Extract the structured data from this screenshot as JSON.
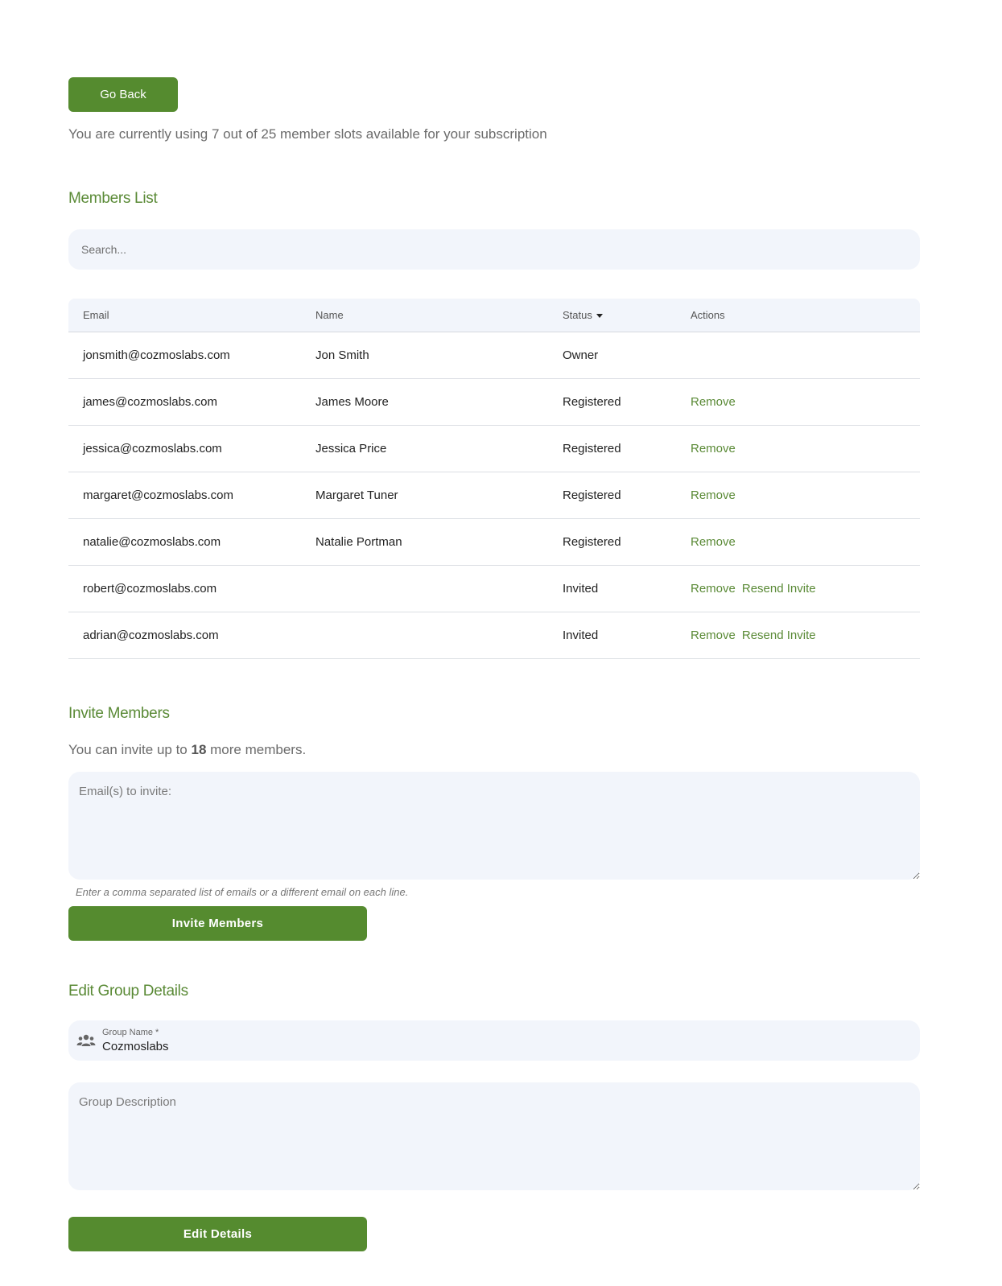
{
  "top": {
    "go_back_label": "Go Back",
    "usage_text": "You are currently using 7 out of 25 member slots available for your subscription"
  },
  "members": {
    "title": "Members List",
    "search_placeholder": "Search...",
    "columns": [
      "Email",
      "Name",
      "Status",
      "Actions"
    ],
    "rows": [
      {
        "email": "jonsmith@cozmoslabs.com",
        "name": "Jon Smith",
        "status": "Owner",
        "actions": []
      },
      {
        "email": "james@cozmoslabs.com",
        "name": "James Moore",
        "status": "Registered",
        "actions": [
          "Remove"
        ]
      },
      {
        "email": "jessica@cozmoslabs.com",
        "name": "Jessica Price",
        "status": "Registered",
        "actions": [
          "Remove"
        ]
      },
      {
        "email": "margaret@cozmoslabs.com",
        "name": "Margaret Tuner",
        "status": "Registered",
        "actions": [
          "Remove"
        ]
      },
      {
        "email": "natalie@cozmoslabs.com",
        "name": "Natalie Portman",
        "status": "Registered",
        "actions": [
          "Remove"
        ]
      },
      {
        "email": "robert@cozmoslabs.com",
        "name": "",
        "status": "Invited",
        "actions": [
          "Remove",
          "Resend Invite"
        ]
      },
      {
        "email": "adrian@cozmoslabs.com",
        "name": "",
        "status": "Invited",
        "actions": [
          "Remove",
          "Resend Invite"
        ]
      }
    ]
  },
  "invite": {
    "title": "Invite Members",
    "text_prefix": "You can invite up to ",
    "count": "18",
    "text_suffix": " more members.",
    "emails_placeholder": "Email(s) to invite:",
    "hint": "Enter a comma separated list of emails or a different email on each line.",
    "button_label": "Invite Members"
  },
  "group": {
    "title": "Edit Group Details",
    "name_icon": "group-icon",
    "name_label": "Group Name *",
    "name_value": "Cozmoslabs",
    "description_placeholder": "Group Description",
    "button_label": "Edit Details"
  },
  "colors": {
    "accent": "#558b2f",
    "field_bg": "#f2f5fb"
  }
}
